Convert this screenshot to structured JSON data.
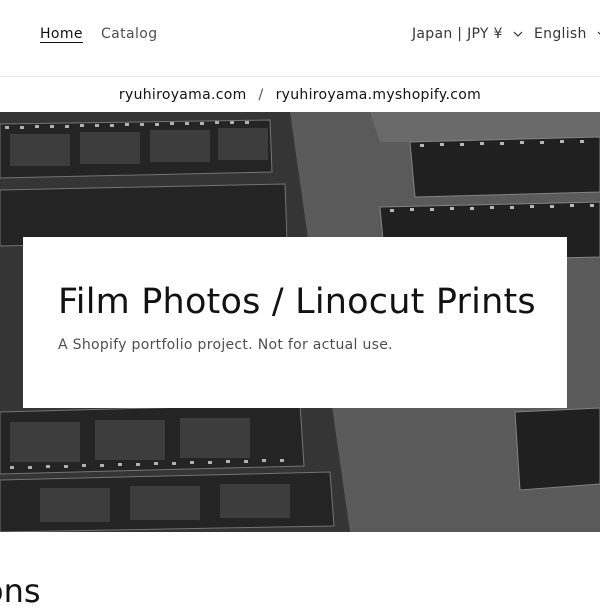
{
  "header": {
    "nav": [
      {
        "label": "Home"
      },
      {
        "label": "Catalog"
      }
    ],
    "country_selector": "Japan | JPY ¥",
    "language_selector": "English"
  },
  "domain_bar": {
    "primary": "ryuhiroyama.com",
    "separator": "/",
    "secondary": "ryuhiroyama.myshopify.com"
  },
  "hero": {
    "title": "Film Photos / Linocut Prints",
    "subtitle": "A Shopify portfolio project. Not for actual use.",
    "background_description": "film-negative-strips-photo"
  },
  "section": {
    "heading_fragment": "ons"
  },
  "colors": {
    "text": "#121212",
    "border": "#e6e6e6",
    "hero_overlay": "#4a4a4a"
  }
}
